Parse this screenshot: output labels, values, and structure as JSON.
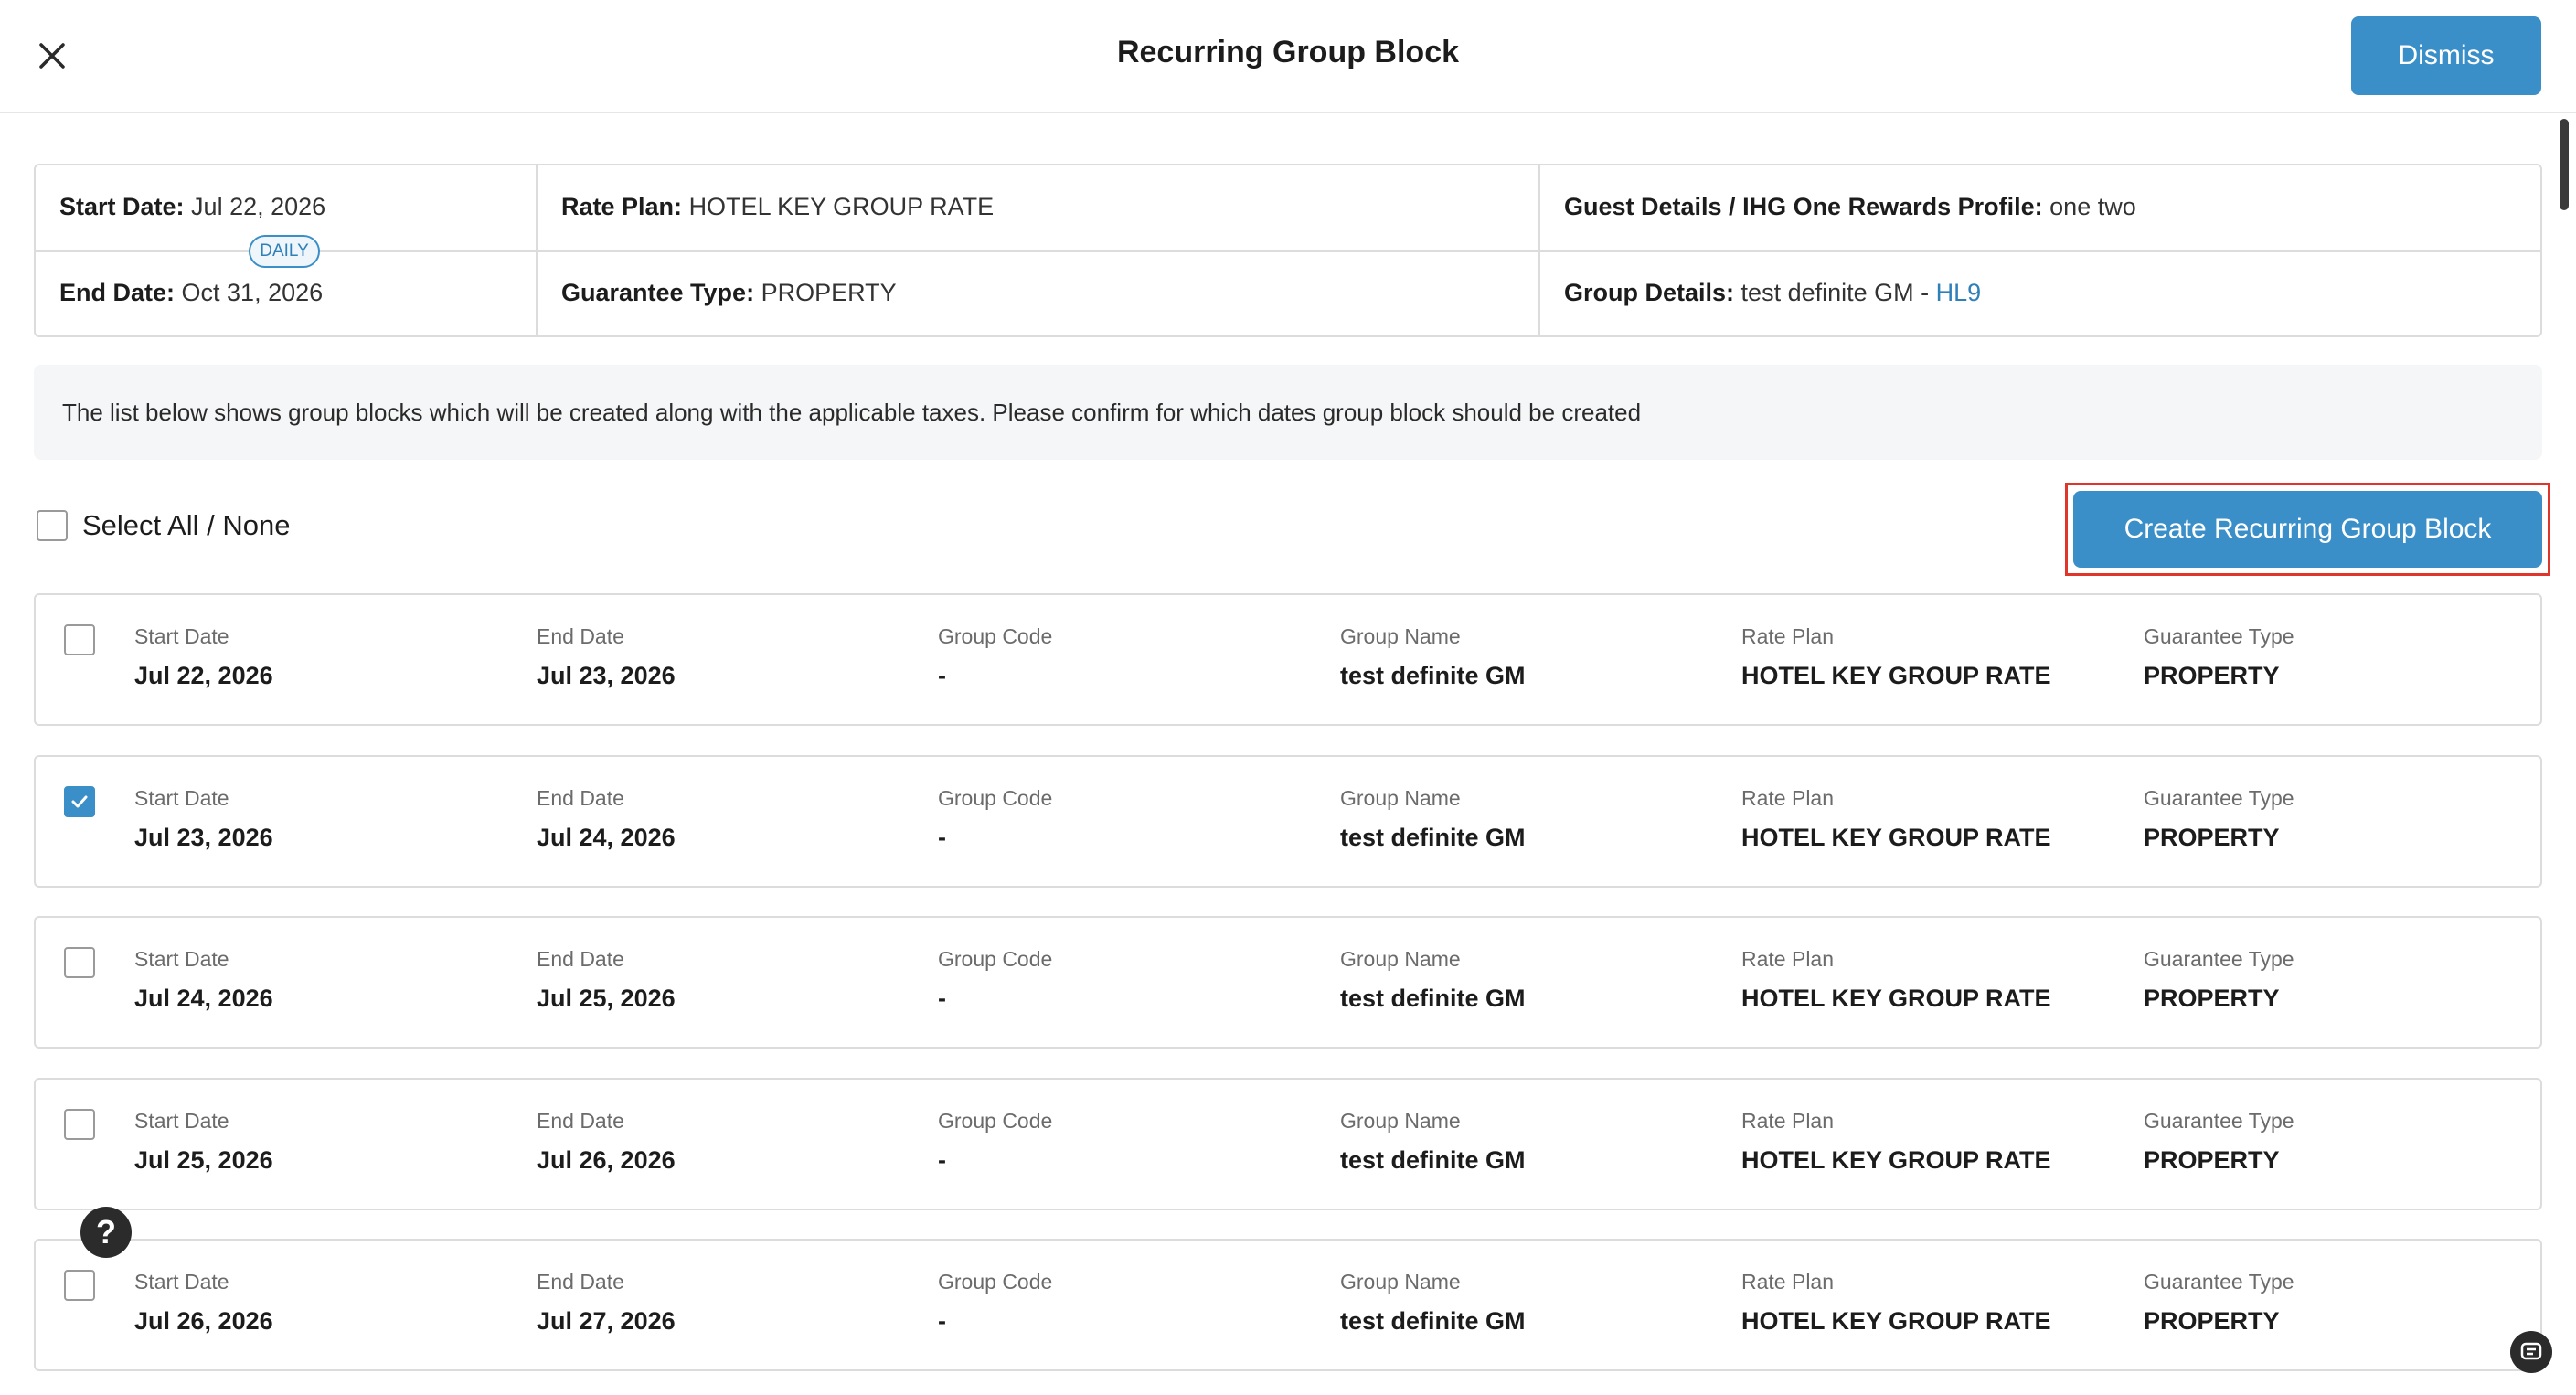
{
  "header": {
    "title": "Recurring Group Block",
    "dismiss_label": "Dismiss",
    "close_icon": "close-icon"
  },
  "summary": {
    "start_date_label": "Start Date:",
    "start_date_value": "Jul 22, 2026",
    "end_date_label": "End Date:",
    "end_date_value": "Oct 31, 2026",
    "frequency_badge": "DAILY",
    "rate_plan_label": "Rate Plan:",
    "rate_plan_value": "HOTEL KEY GROUP RATE",
    "guarantee_type_label": "Guarantee Type:",
    "guarantee_type_value": "PROPERTY",
    "guest_details_label": "Guest Details / IHG One Rewards Profile:",
    "guest_details_value": "one two",
    "group_details_label": "Group Details:",
    "group_details_value": "test definite GM - ",
    "group_details_link": "HL9"
  },
  "info_text": "The list below shows group blocks which will be created along with the applicable taxes. Please confirm for which dates group block should be created",
  "select_all_label": "Select All / None",
  "create_button_label": "Create Recurring Group Block",
  "column_labels": {
    "start_date": "Start Date",
    "end_date": "End Date",
    "group_code": "Group Code",
    "group_name": "Group Name",
    "rate_plan": "Rate Plan",
    "guarantee_type": "Guarantee Type"
  },
  "rows": [
    {
      "checked": false,
      "start_date": "Jul 22, 2026",
      "end_date": "Jul 23, 2026",
      "group_code": "-",
      "group_name": "test definite GM",
      "rate_plan": "HOTEL KEY GROUP RATE",
      "guarantee_type": "PROPERTY"
    },
    {
      "checked": true,
      "start_date": "Jul 23, 2026",
      "end_date": "Jul 24, 2026",
      "group_code": "-",
      "group_name": "test definite GM",
      "rate_plan": "HOTEL KEY GROUP RATE",
      "guarantee_type": "PROPERTY"
    },
    {
      "checked": false,
      "start_date": "Jul 24, 2026",
      "end_date": "Jul 25, 2026",
      "group_code": "-",
      "group_name": "test definite GM",
      "rate_plan": "HOTEL KEY GROUP RATE",
      "guarantee_type": "PROPERTY"
    },
    {
      "checked": false,
      "start_date": "Jul 25, 2026",
      "end_date": "Jul 26, 2026",
      "group_code": "-",
      "group_name": "test definite GM",
      "rate_plan": "HOTEL KEY GROUP RATE",
      "guarantee_type": "PROPERTY"
    },
    {
      "checked": false,
      "start_date": "Jul 26, 2026",
      "end_date": "Jul 27, 2026",
      "group_code": "-",
      "group_name": "test definite GM",
      "rate_plan": "HOTEL KEY GROUP RATE",
      "guarantee_type": "PROPERTY"
    }
  ],
  "help_label": "?",
  "colors": {
    "accent": "#3a8fc8",
    "highlight_outline": "#e0352b",
    "link": "#2f7fb8"
  }
}
